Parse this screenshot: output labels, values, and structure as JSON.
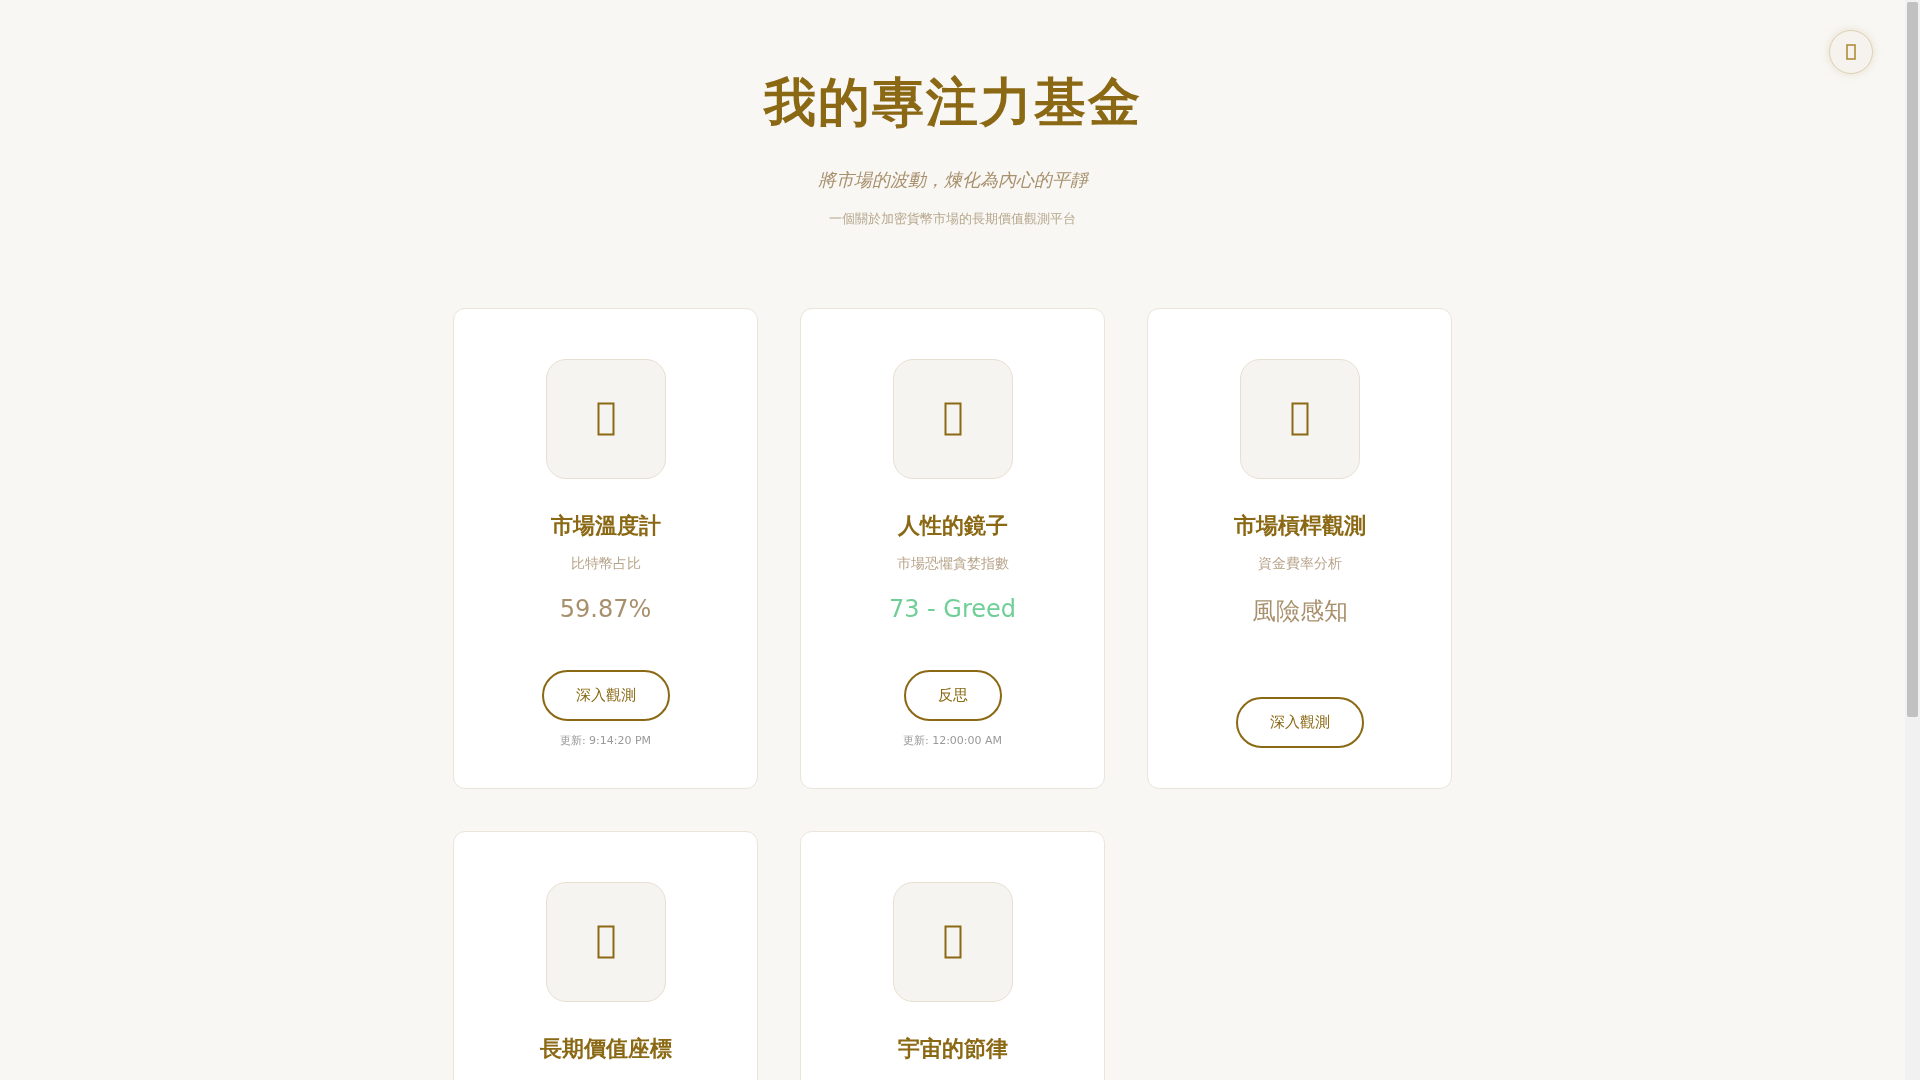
{
  "header": {
    "title": "我的專注力基金",
    "tagline": "將市場的波動，煉化為內心的平靜",
    "description": "一個關於加密貨幣市場的長期價值觀測平台"
  },
  "cards": [
    {
      "title": "市場溫度計",
      "subtitle": "比特幣占比",
      "value": "59.87%",
      "color": "#a8906c",
      "button": "深入觀測",
      "updated": "更新: 9:14:20 PM"
    },
    {
      "title": "人性的鏡子",
      "subtitle": "市場恐懼貪婪指數",
      "value": "73 - Greed",
      "color": "#6fcf97",
      "button": "反思",
      "updated": "更新: 12:00:00 AM"
    },
    {
      "title": "市場槓桿觀測",
      "subtitle": "資金費率分析",
      "value": "風險感知",
      "color": "#a8906c",
      "button": "深入觀測"
    },
    {
      "title": "長期價值座標"
    },
    {
      "title": "宇宙的節律"
    }
  ]
}
